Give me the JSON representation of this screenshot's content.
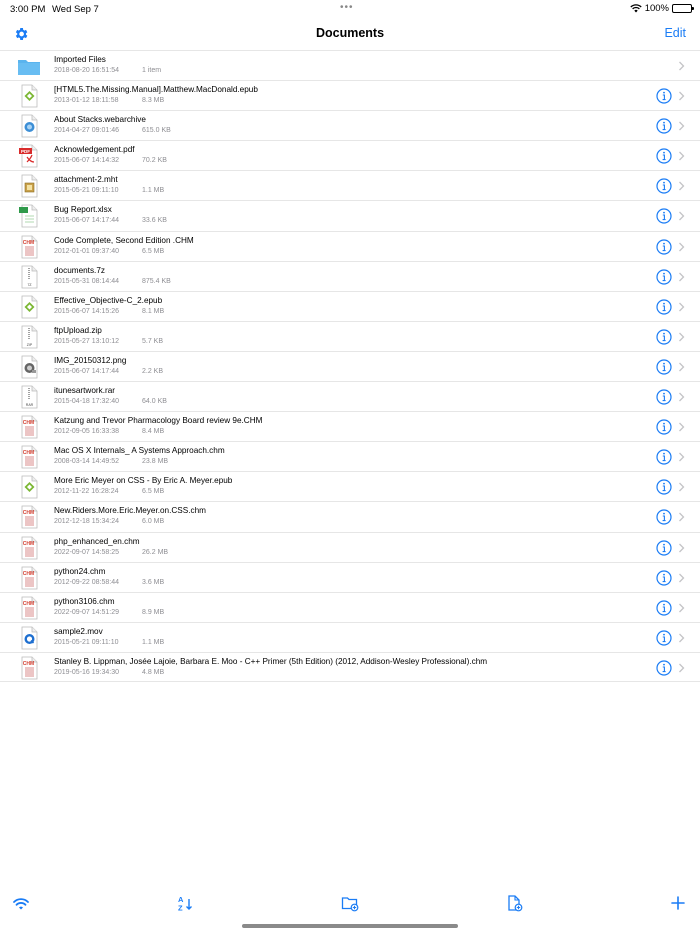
{
  "status_bar": {
    "time": "3:00 PM",
    "date": "Wed Sep 7",
    "battery": "100%"
  },
  "nav": {
    "title": "Documents",
    "edit_label": "Edit"
  },
  "colors": {
    "accent": "#1a7cf5",
    "folder": "#5ab4ee",
    "separator": "#e6e6e6",
    "secondary_text": "#8e8e93"
  },
  "files": [
    {
      "name": "Imported Files",
      "date": "2018-08-20 16:51:54",
      "size": "1 item",
      "icon": "folder-icon",
      "has_info": false
    },
    {
      "name": "[HTML5.The.Missing.Manual].Matthew.MacDonald.epub",
      "date": "2013-01-12 18:11:58",
      "size": "8.3 MB",
      "icon": "epub-icon",
      "has_info": true
    },
    {
      "name": "About Stacks.webarchive",
      "date": "2014-04-27 09:01:46",
      "size": "615.0 KB",
      "icon": "webarchive-icon",
      "has_info": true
    },
    {
      "name": "Acknowledgement.pdf",
      "date": "2015-06-07 14:14:32",
      "size": "70.2 KB",
      "icon": "pdf-icon",
      "has_info": true
    },
    {
      "name": "attachment-2.mht",
      "date": "2015-05-21 09:11:10",
      "size": "1.1 MB",
      "icon": "mht-icon",
      "has_info": true
    },
    {
      "name": "Bug Report.xlsx",
      "date": "2015-06-07 14:17:44",
      "size": "33.6 KB",
      "icon": "xlsx-icon",
      "has_info": true
    },
    {
      "name": "Code Complete, Second Edition .CHM",
      "date": "2012-01-01 09:37:40",
      "size": "6.5 MB",
      "icon": "chm-icon",
      "has_info": true
    },
    {
      "name": "documents.7z",
      "date": "2015-05-31 08:14:44",
      "size": "875.4 KB",
      "icon": "7z-icon",
      "has_info": true
    },
    {
      "name": "Effective_Objective-C_2.epub",
      "date": "2015-06-07 14:15:26",
      "size": "8.1 MB",
      "icon": "epub-icon",
      "has_info": true
    },
    {
      "name": "ftpUpload.zip",
      "date": "2015-05-27 13:10:12",
      "size": "5.7 KB",
      "icon": "zip-icon",
      "has_info": true
    },
    {
      "name": "IMG_20150312.png",
      "date": "2015-06-07 14:17:44",
      "size": "2.2 KB",
      "icon": "image-icon",
      "has_info": true
    },
    {
      "name": "itunesartwork.rar",
      "date": "2015-04-18 17:32:40",
      "size": "64.0 KB",
      "icon": "rar-icon",
      "has_info": true
    },
    {
      "name": "Katzung and Trevor Pharmacology Board review 9e.CHM",
      "date": "2012-09-05 16:33:38",
      "size": "8.4 MB",
      "icon": "chm-icon",
      "has_info": true
    },
    {
      "name": "Mac OS X Internals_ A Systems Approach.chm",
      "date": "2008-03-14 14:49:52",
      "size": "23.8 MB",
      "icon": "chm-icon",
      "has_info": true
    },
    {
      "name": "More Eric Meyer on CSS - By Eric A. Meyer.epub",
      "date": "2012-11-22 16:28:24",
      "size": "6.5 MB",
      "icon": "epub-icon",
      "has_info": true
    },
    {
      "name": "New.Riders.More.Eric.Meyer.on.CSS.chm",
      "date": "2012-12-18 15:34:24",
      "size": "6.0 MB",
      "icon": "chm-icon",
      "has_info": true
    },
    {
      "name": "php_enhanced_en.chm",
      "date": "2022-09-07 14:58:25",
      "size": "26.2 MB",
      "icon": "chm-icon",
      "has_info": true
    },
    {
      "name": "python24.chm",
      "date": "2012-09-22 08:58:44",
      "size": "3.6 MB",
      "icon": "chm-icon",
      "has_info": true
    },
    {
      "name": "python3106.chm",
      "date": "2022-09-07 14:51:29",
      "size": "8.9 MB",
      "icon": "chm-icon",
      "has_info": true
    },
    {
      "name": "sample2.mov",
      "date": "2015-05-21 09:11:10",
      "size": "1.1 MB",
      "icon": "quicktime-icon",
      "has_info": true
    },
    {
      "name": "Stanley B. Lippman, Josée Lajoie, Barbara E. Moo - C++ Primer (5th Edition) (2012, Addison-Wesley Professional).chm",
      "date": "2019-05-16 19:34:30",
      "size": "4.8 MB",
      "icon": "chm-icon",
      "has_info": true
    }
  ],
  "toolbar": [
    {
      "name": "wifi-transfer-icon"
    },
    {
      "name": "sort-az-icon"
    },
    {
      "name": "new-folder-icon"
    },
    {
      "name": "new-file-icon"
    },
    {
      "name": "add-icon"
    }
  ]
}
